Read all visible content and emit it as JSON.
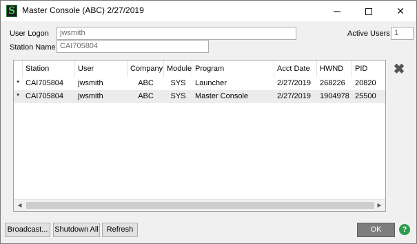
{
  "window": {
    "title": "Master Console (ABC) 2/27/2019",
    "icon": "sage-s-icon",
    "controls": {
      "minimize": "─",
      "close": "✕"
    }
  },
  "form": {
    "user_logon_label": "User Logon",
    "user_logon_value": "jwsmith",
    "station_name_label": "Station Name",
    "station_name_value": "CAI705804",
    "active_users_label": "Active Users",
    "active_users_value": "1"
  },
  "table": {
    "columns": [
      "Station",
      "User",
      "Company",
      "Module",
      "Program",
      "Acct Date",
      "HWND",
      "PID"
    ],
    "rows": [
      {
        "marker": "*",
        "station": "CAI705804",
        "user": "jwsmith",
        "company": "ABC",
        "module": "SYS",
        "program": "Launcher",
        "acct_date": "2/27/2019",
        "hwnd": "268226",
        "pid": "20820"
      },
      {
        "marker": "*",
        "station": "CAI705804",
        "user": "jwsmith",
        "company": "ABC",
        "module": "SYS",
        "program": "Master Console",
        "acct_date": "2/27/2019",
        "hwnd": "1904978",
        "pid": "25500"
      }
    ]
  },
  "buttons": {
    "broadcast": "Broadcast...",
    "shutdown_all": "Shutdown All",
    "refresh": "Refresh",
    "ok": "OK",
    "delete_icon": "✖",
    "help_icon": "?"
  },
  "colors": {
    "ok_button": "#7d7d7d",
    "help_green": "#2e9a4b",
    "alt_row": "#ececec"
  }
}
